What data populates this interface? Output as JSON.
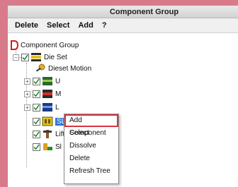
{
  "window": {
    "title": "Component Group"
  },
  "menubar": {
    "items": [
      "Delete",
      "Select",
      "Add",
      "?"
    ]
  },
  "tree": {
    "root": {
      "label": "Component Group",
      "icon": "component-group-logo-icon"
    },
    "die_set": {
      "label": "Die Set",
      "icon": "die-set-icon"
    },
    "diesel_motion": {
      "label": "Dieset Motion",
      "icon": "motion-key-icon"
    },
    "u": {
      "label": "U",
      "icon": "upper-die-icon"
    },
    "m": {
      "label": "M",
      "icon": "middle-die-icon"
    },
    "l": {
      "label": "L",
      "icon": "lower-die-icon"
    },
    "sl": {
      "label": "SL",
      "icon": "slide-die-icon"
    },
    "lift": {
      "label": "Lift",
      "icon": "lifter-icon"
    },
    "slide": {
      "label": "Sl",
      "icon": "slider-icon"
    }
  },
  "context_menu": {
    "items": [
      "Add Component",
      "Select",
      "Dissolve",
      "Delete",
      "Refresh Tree"
    ],
    "highlighted": "Add Component",
    "highlight_color": "#d8343c"
  },
  "colors": {
    "selection": "#2f79d6",
    "background_edge": "#d97a8a"
  }
}
